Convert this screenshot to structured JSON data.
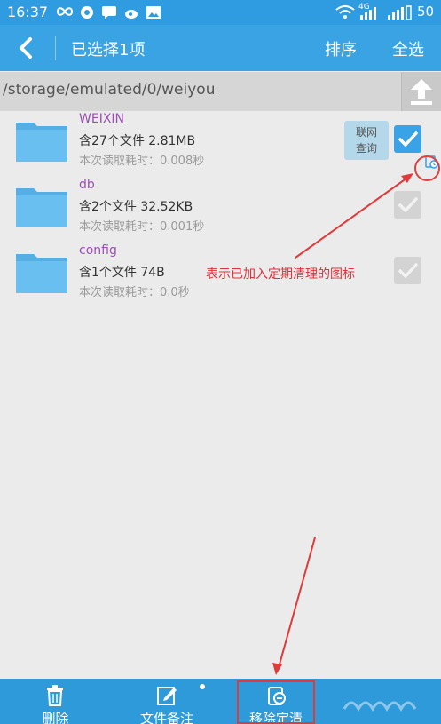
{
  "status_bar": {
    "time": "16:37",
    "battery": "50",
    "signal": "4G"
  },
  "header": {
    "title": "已选择1项",
    "sort_label": "排序",
    "select_all_label": "全选"
  },
  "path_bar": {
    "path": "/storage/emulated/0/weiyou"
  },
  "files": [
    {
      "name": "WEIXIN",
      "info": "含27个文件  2.81MB",
      "read_time": "本次读取耗时：0.008秒",
      "checked": true
    },
    {
      "name": "db",
      "info": "含2个文件  32.52KB",
      "read_time": "本次读取耗时：0.001秒",
      "checked": false
    },
    {
      "name": "config",
      "info": "含1个文件  74B",
      "read_time": "本次读取耗时：0.0秒",
      "checked": false
    }
  ],
  "online_query": {
    "line1": "联网",
    "line2": "查询"
  },
  "annotation": {
    "text": "表示已加入定期清理的图标"
  },
  "bottom_toolbar": {
    "delete_label": "删除",
    "note_label": "文件备注",
    "remove_clean_label": "移除定清"
  },
  "colors": {
    "accent": "#39a3e4",
    "checkbox": "#3aa2e6",
    "annotation": "#e0303a",
    "file_name": "#9a4fb4"
  }
}
